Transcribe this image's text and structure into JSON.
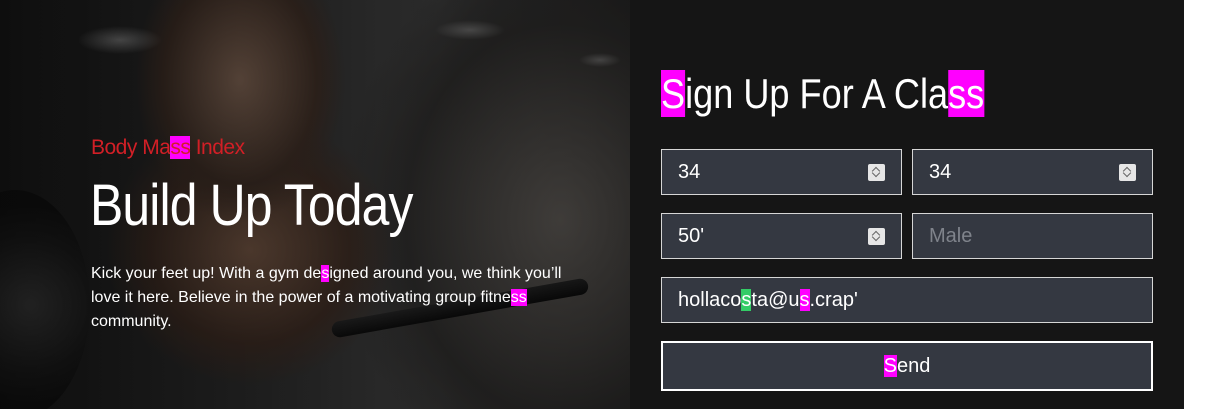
{
  "hero": {
    "subtitle": {
      "a": "Body Ma",
      "b": "ss",
      "c": " Index"
    },
    "title": "Build Up Today",
    "description": {
      "a": "Kick your feet up! With a gym de",
      "b": "s",
      "c": "igned around you, we think you’ll love it here. Believe in the power of a motivating group fitne",
      "d": "ss",
      "e": " community."
    }
  },
  "form": {
    "title": {
      "a": "S",
      "b": "ign Up For A Cla",
      "c": "ss"
    },
    "fields": {
      "field_1": "34",
      "field_2": "34",
      "field_3": "50'",
      "gender_placeholder": "Male",
      "email": {
        "a": "hollaco",
        "b": "s",
        "c": "ta@u",
        "d": "s",
        "e": ".crap'"
      }
    },
    "send_button": {
      "a": "S",
      "b": "end"
    }
  },
  "colors": {
    "accent_red": "#d21f26",
    "panel_bg": "#151515",
    "field_bg": "#343841",
    "highlight_magenta": "#ff00ff",
    "highlight_green": "#33cc66"
  }
}
